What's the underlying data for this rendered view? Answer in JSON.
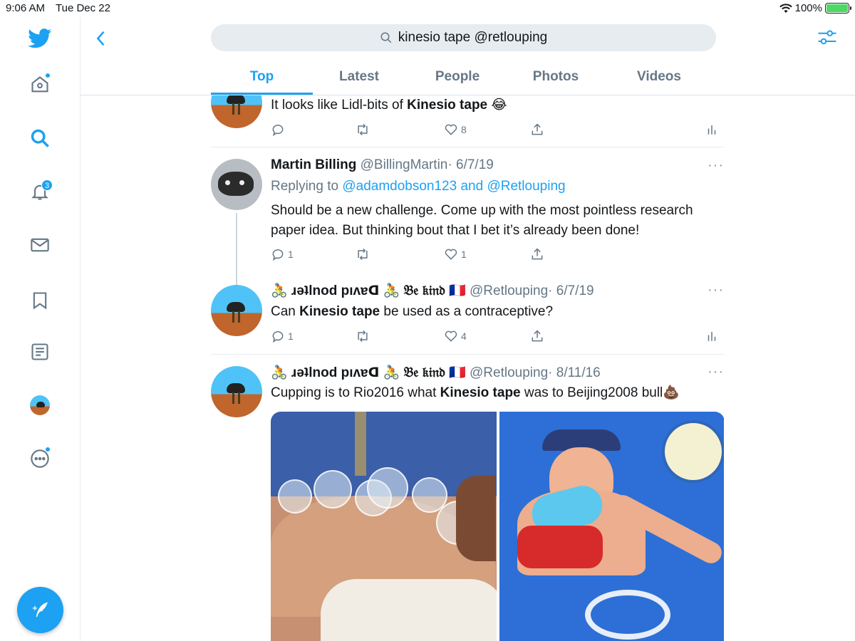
{
  "status_bar": {
    "time": "9:06 AM",
    "date": "Tue Dec 22",
    "battery": "100%",
    "battery_level": 1.0
  },
  "sidebar": {
    "notifications_badge": "3"
  },
  "search": {
    "query": "kinesio tape @retlouping"
  },
  "tabs": [
    {
      "label": "Top"
    },
    {
      "label": "Latest"
    },
    {
      "label": "People"
    },
    {
      "label": "Photos"
    },
    {
      "label": "Videos"
    }
  ],
  "tweets": [
    {
      "text_pre": "It looks like Lidl-bits of ",
      "text_bold": "Kinesio tape",
      "text_post": " 😂",
      "likes": "8"
    },
    {
      "name": "Martin Billing",
      "handle": "@BillingMartin",
      "date": "· 6/7/19",
      "replying_prefix": "Replying to ",
      "replying_to": "@adamdobson123 and @Retlouping",
      "text_line1": "Should be a new challenge. Come up with the most pointless research",
      "text_line2": "paper idea. But thinking bout that I bet it’s already been done!",
      "replies": "1",
      "likes": "1"
    },
    {
      "name": "🚴 ɹǝʇlnod pıʌɐᗡ 🚴 𝔅𝔢 𝔨𝔦𝔫𝔡 🇫🇷",
      "handle": "@Retlouping",
      "date": "· 6/7/19",
      "text_pre": "Can ",
      "text_bold": "Kinesio tape",
      "text_post": " be used as a contraceptive?",
      "replies": "1",
      "likes": "4"
    },
    {
      "name": "🚴 ɹǝʇlnod pıʌɐᗡ 🚴 𝔅𝔢 𝔨𝔦𝔫𝔡 🇫🇷",
      "handle": "@Retlouping",
      "date": "· 8/11/16",
      "text_pre": "Cupping is to Rio2016 what ",
      "text_bold": "Kinesio tape",
      "text_post": " was to Beijing2008 bull💩"
    }
  ],
  "colors": {
    "accent": "#1da1f2",
    "muted": "#657786",
    "divider": "#e6ecf0"
  }
}
